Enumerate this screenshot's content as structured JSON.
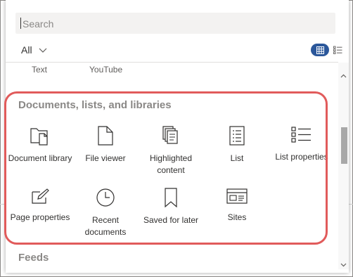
{
  "search": {
    "placeholder": "Search",
    "value": ""
  },
  "filter": {
    "label": "All"
  },
  "view_toggle": {
    "active": "grid"
  },
  "previous_row": [
    "Text",
    "YouTube"
  ],
  "sections": [
    {
      "heading": "Documents, lists, and libraries",
      "tiles": [
        {
          "label": "Document library",
          "icon": "document-library-icon"
        },
        {
          "label": "File viewer",
          "icon": "file-viewer-icon"
        },
        {
          "label": "Highlighted content",
          "icon": "highlighted-content-icon"
        },
        {
          "label": "List",
          "icon": "list-icon"
        },
        {
          "label": "List properties",
          "icon": "list-properties-icon"
        },
        {
          "label": "Page properties",
          "icon": "page-properties-icon"
        },
        {
          "label": "Recent documents",
          "icon": "recent-documents-icon"
        },
        {
          "label": "Saved for later",
          "icon": "saved-for-later-icon"
        },
        {
          "label": "Sites",
          "icon": "sites-icon"
        }
      ]
    },
    {
      "heading": "Feeds",
      "tiles": []
    }
  ],
  "colors": {
    "accent": "#2b579a",
    "highlight": "#e15b5b",
    "heading": "#8a8886"
  }
}
